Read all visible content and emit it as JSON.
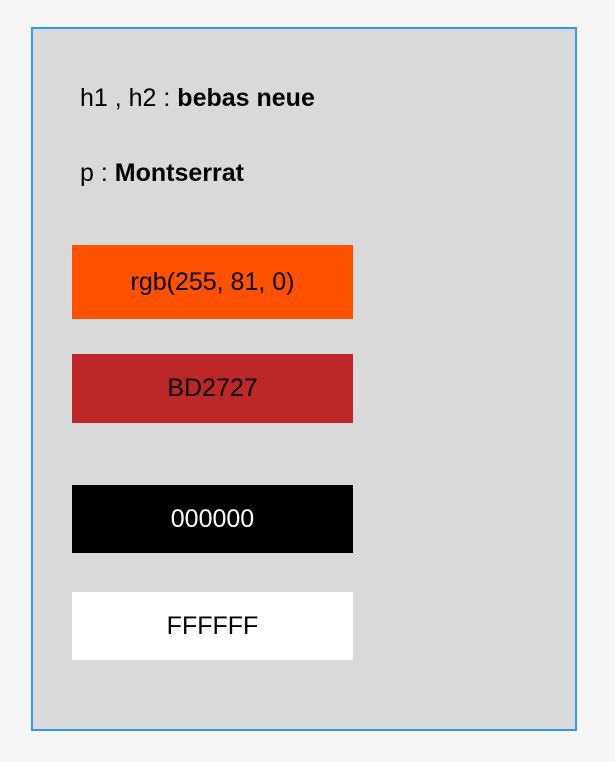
{
  "fonts": {
    "headings": {
      "label": "h1 , h2 : ",
      "value": "bebas neue"
    },
    "paragraph": {
      "label": "p : ",
      "value": "Montserrat"
    }
  },
  "swatches": [
    {
      "label": "rgb(255, 81, 0)",
      "color": "#ff5100",
      "text_color": "#000000"
    },
    {
      "label": "BD2727",
      "color": "#bd2727",
      "text_color": "#000000"
    },
    {
      "label": "000000",
      "color": "#000000",
      "text_color": "#ffffff"
    },
    {
      "label": "FFFFFF",
      "color": "#ffffff",
      "text_color": "#000000"
    }
  ]
}
